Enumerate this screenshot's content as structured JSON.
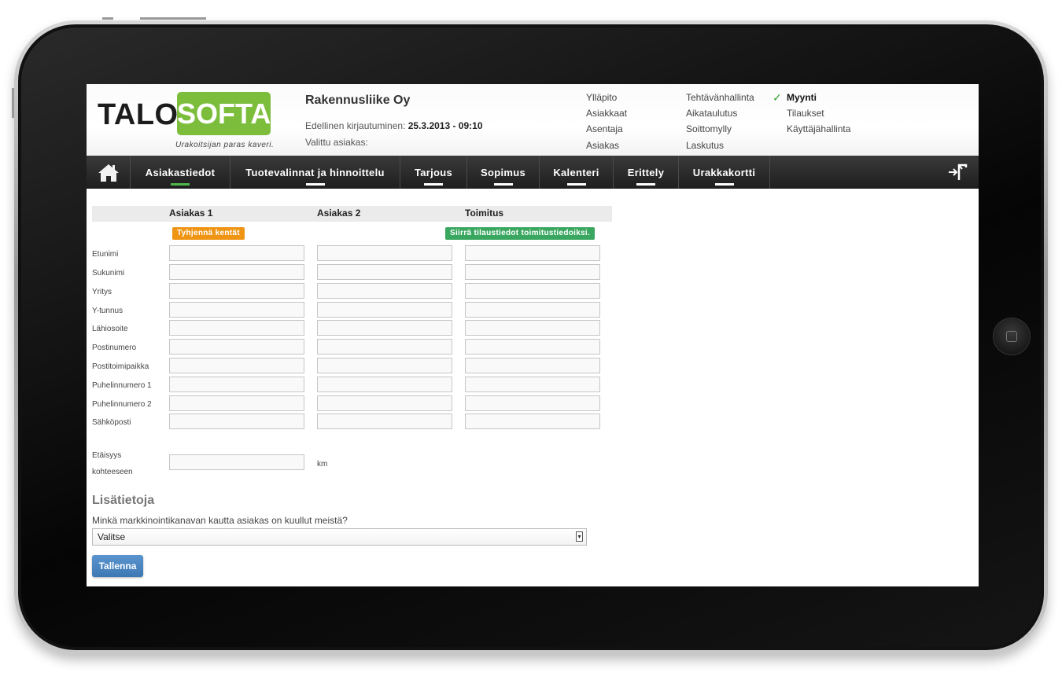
{
  "logo": {
    "part1": "TALO",
    "part2": "SOFTA",
    "tagline": "Urakoitsijan paras kaveri."
  },
  "header": {
    "company": "Rakennusliike Oy",
    "last_login_label": "Edellinen kirjautuminen:",
    "last_login_value": "25.3.2013 - 09:10",
    "selected_customer_label": "Valittu asiakas:"
  },
  "top_menu": {
    "col1": [
      "Ylläpito",
      "Asiakkaat",
      "Asentaja",
      "Asiakas"
    ],
    "col2": [
      "Tehtävänhallinta",
      "Aikataulutus",
      "Soittomylly",
      "Laskutus"
    ],
    "col3": [
      "Myynti",
      "Tilaukset",
      "Käyttäjähallinta"
    ],
    "active": "Myynti"
  },
  "nav": {
    "items": [
      "Asiakastiedot",
      "Tuotevalinnat ja hinnoittelu",
      "Tarjous",
      "Sopimus",
      "Kalenteri",
      "Erittely",
      "Urakkakortti"
    ],
    "active": "Asiakastiedot",
    "icons": [
      "home-icon",
      "logout-icon"
    ]
  },
  "form": {
    "columns": [
      "Asiakas 1",
      "Asiakas 2",
      "Toimitus"
    ],
    "clear_button": "Tyhjennä kentät",
    "copy_button": "Siirrä tilaustiedot toimitustiedoiksi.",
    "rows": [
      "Etunimi",
      "Sukunimi",
      "Yritys",
      "Y-tunnus",
      "Lähiosoite",
      "Postinumero",
      "Postitoimipaikka",
      "Puhelinnumero 1",
      "Puhelinnumero 2",
      "Sähköposti"
    ],
    "distance_label_1": "Etäisyys",
    "distance_label_2": "kohteeseen",
    "distance_unit": "km"
  },
  "extra": {
    "title": "Lisätietoja",
    "question": "Minkä markkinointikanavan kautta asiakas on kuullut meistä?",
    "select_value": "Valitse",
    "save_button": "Tallenna"
  },
  "colors": {
    "brand_green": "#7cbe3c",
    "orange": "#ef9413",
    "green_button": "#3aa760",
    "blue_button": "#3d78b4",
    "nav_bg": "#2a2a2a"
  }
}
